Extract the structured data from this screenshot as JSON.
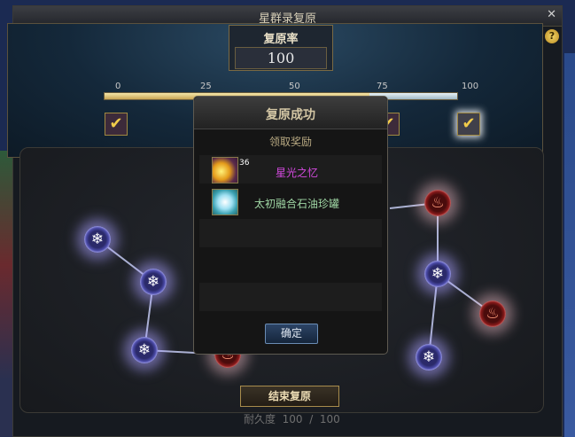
{
  "window": {
    "title": "星群录复原"
  },
  "rate": {
    "title": "复原率",
    "value": "100",
    "progress_percent": 100
  },
  "ticks": [
    "0",
    "25",
    "50",
    "75",
    "100"
  ],
  "board": {
    "ice_icon": "snowflake-icon",
    "fire_icon": "flame-icon"
  },
  "footer": {
    "end_button": "结束复原",
    "durability_label": "耐久度",
    "durability_current": "100",
    "durability_separator": "/",
    "durability_max": "100"
  },
  "modal": {
    "title": "复原成功",
    "subtitle": "领取奖励",
    "rewards": [
      {
        "icon": "star-light-icon",
        "count": "36",
        "name": "星光之忆",
        "color": "#d54ae0"
      },
      {
        "icon": "crystal-jar-icon",
        "count": "",
        "name": "太初融合石油珍罐",
        "color": "#9fd6a4"
      }
    ],
    "confirm": "确定"
  },
  "colors": {
    "accent_gold": "#c7a453",
    "ice_glow": "#b9b8ff",
    "fire_glow": "#ffb0b0"
  }
}
